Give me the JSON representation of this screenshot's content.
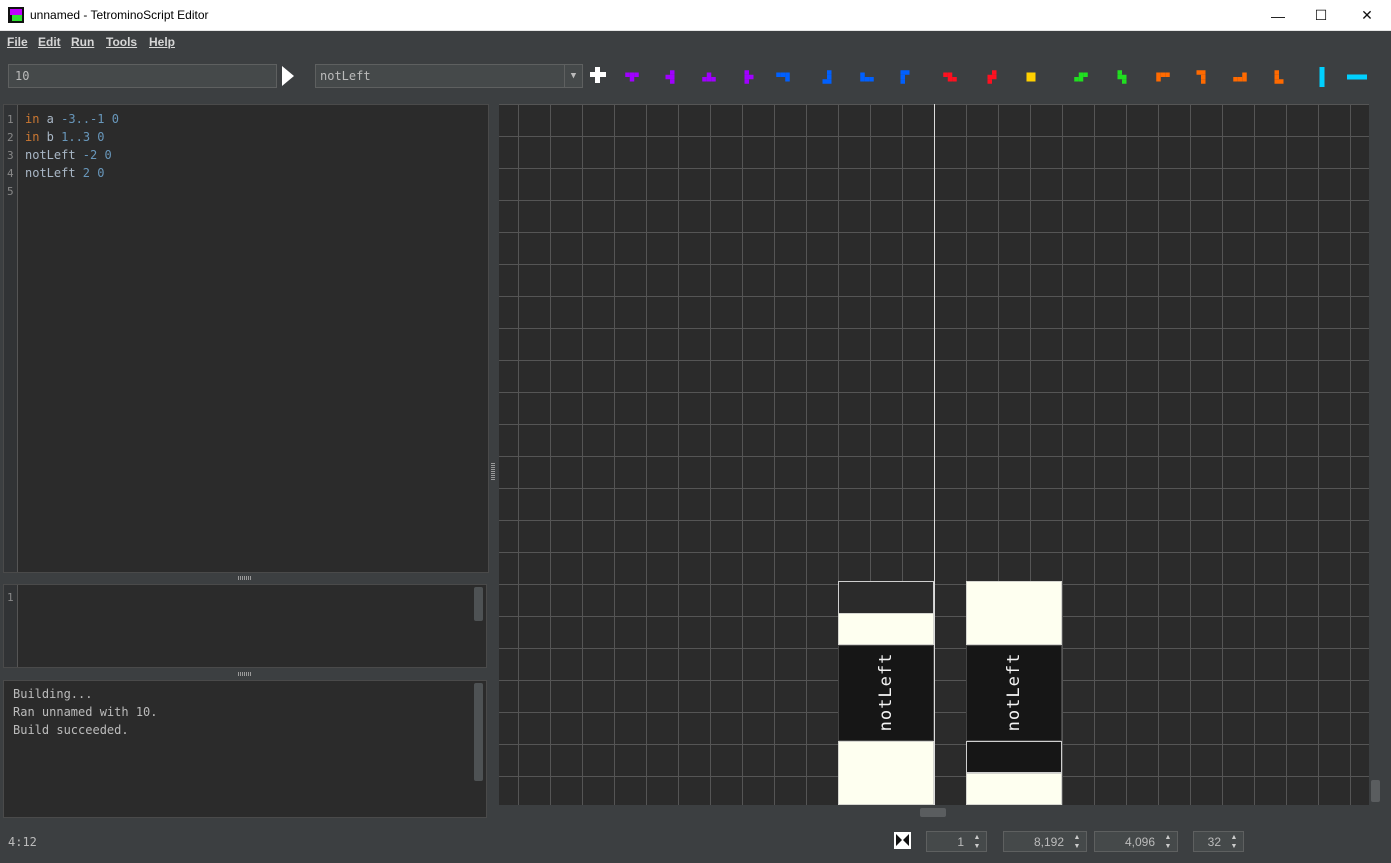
{
  "window": {
    "title": "unnamed - TetrominoScript Editor",
    "minimize": "—",
    "maximize": "☐",
    "close": "✕"
  },
  "menu": [
    "File",
    "Edit",
    "Run",
    "Tools",
    "Help"
  ],
  "toolbar": {
    "argument_value": "10",
    "selected_function": "notLeft",
    "pieces": [
      {
        "name": "t-up",
        "color": "#a000ff"
      },
      {
        "name": "t-left",
        "color": "#a000ff"
      },
      {
        "name": "t-down",
        "color": "#a000ff"
      },
      {
        "name": "t-right",
        "color": "#a000ff"
      },
      {
        "name": "j-left",
        "color": "#0060ff"
      },
      {
        "name": "j-up",
        "color": "#0060ff"
      },
      {
        "name": "j-right",
        "color": "#0060ff"
      },
      {
        "name": "j-down",
        "color": "#0060ff"
      },
      {
        "name": "z-horizontal",
        "color": "#ff1020"
      },
      {
        "name": "z-vertical",
        "color": "#ff1020"
      },
      {
        "name": "o",
        "color": "#ffd000"
      },
      {
        "name": "s-horizontal",
        "color": "#20e020"
      },
      {
        "name": "s-vertical",
        "color": "#20e020"
      },
      {
        "name": "l-left",
        "color": "#ff6a00"
      },
      {
        "name": "l-up",
        "color": "#ff6a00"
      },
      {
        "name": "l-right",
        "color": "#ff6a00"
      },
      {
        "name": "l-down",
        "color": "#ff6a00"
      },
      {
        "name": "i-vertical",
        "color": "#00d0ff"
      },
      {
        "name": "i-horizontal",
        "color": "#00d0ff"
      }
    ]
  },
  "editor": {
    "lines": [
      {
        "n": "1",
        "kw": "in",
        "rest": " a ",
        "args": "-3..-1 0"
      },
      {
        "n": "2",
        "kw": "in",
        "rest": " b ",
        "args": "1..3 0"
      },
      {
        "n": "3",
        "kw": "",
        "rest": "notLeft ",
        "args": "-2 0"
      },
      {
        "n": "4",
        "kw": "",
        "rest": "notLeft ",
        "args": "2 0"
      },
      {
        "n": "5",
        "kw": "",
        "rest": "",
        "args": ""
      }
    ]
  },
  "sub_editor": {
    "line_number": "1"
  },
  "console": {
    "lines": [
      "Building...",
      "Ran unnamed with 10.",
      "Build succeeded."
    ]
  },
  "canvas": {
    "labels": [
      "notLeft",
      "notLeft"
    ]
  },
  "status": {
    "cursor": "4:12",
    "spinners": [
      "1",
      "8,192",
      "4,096",
      "32"
    ]
  }
}
